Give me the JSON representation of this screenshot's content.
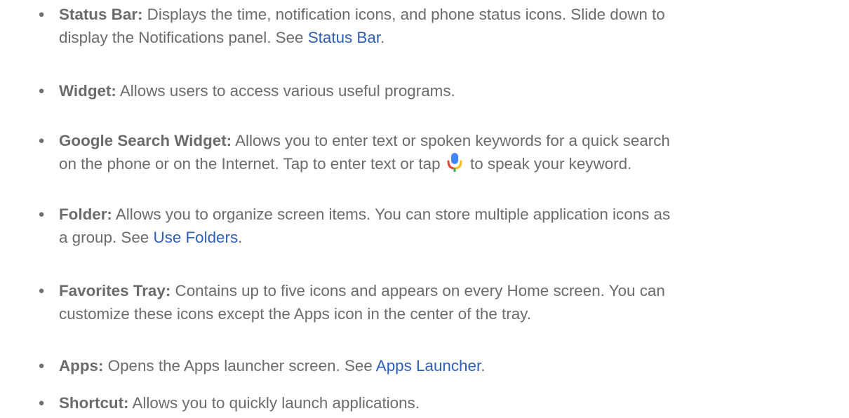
{
  "items": [
    {
      "term": "Status Bar:",
      "text": " Displays the time, notification icons, and phone status icons. Slide down to",
      "text2": "display the Notifications panel. See ",
      "link": "Status Bar",
      "after": "."
    },
    {
      "term": "Widget:",
      "text": " Allows users to access various useful programs."
    },
    {
      "term": "Google Search Widget:",
      "text": " Allows you to enter text or spoken keywords for a quick search",
      "text2": "on the phone or on the Internet. Tap to enter text or tap ",
      "text3": " to speak your keyword.",
      "icon": "microphone-icon"
    },
    {
      "term": "Folder:",
      "text": " Allows you to organize screen items. You can store multiple application icons as",
      "text2": "a group. See ",
      "link": "Use Folders",
      "after": "."
    },
    {
      "term": "Favorites Tray:",
      "text": " Contains up to five icons and appears on every Home screen. You can",
      "text2": "customize these icons except the Apps icon in the center of the tray."
    },
    {
      "term": "Apps:",
      "text": " Opens the Apps launcher screen. See ",
      "link": "Apps Launcher",
      "after": "."
    },
    {
      "term": "Shortcut:",
      "text": " Allows you to quickly launch applications."
    }
  ],
  "bullet": "●",
  "colors": {
    "text": "#6b6b6b",
    "link": "#2f5fb3",
    "mic_blue": "#4285f4",
    "mic_red": "#ea4335",
    "mic_yellow": "#fbbc05",
    "mic_green": "#34a853"
  }
}
